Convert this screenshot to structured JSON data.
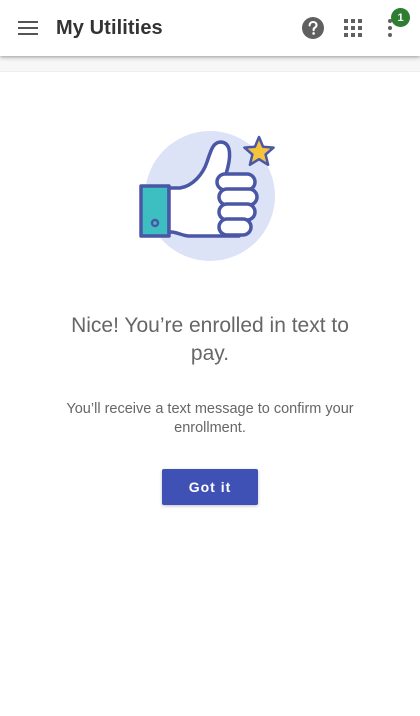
{
  "app_bar": {
    "title": "My Utilities",
    "menu_icon": "hamburger-menu-icon",
    "help_icon": "help-circle-icon",
    "apps_icon": "apps-grid-icon",
    "more_icon": "more-vert-icon",
    "notification_count": "1"
  },
  "content": {
    "illustration_icon": "thumbs-up-star-illustration",
    "headline": "Nice! You’re enrolled in text to pay.",
    "message": "You’ll receive a text message to confirm your enrollment.",
    "button_label": "Got it"
  },
  "colors": {
    "primary": "#3f51b5",
    "badge": "#2e7d32",
    "illustration_circle": "#dde3f7",
    "star": "#f6c33c",
    "cuff": "#3dbfc1"
  }
}
